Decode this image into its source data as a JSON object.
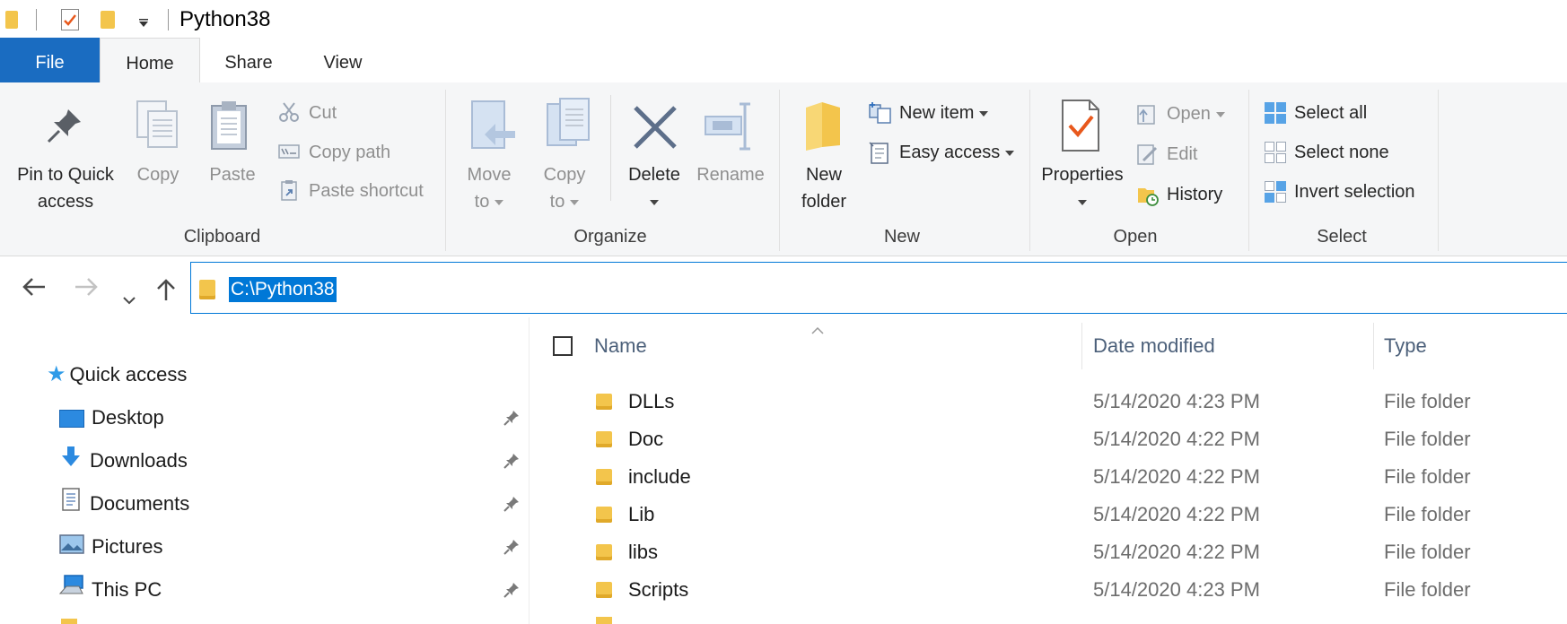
{
  "window": {
    "title": "Python38"
  },
  "tabs": {
    "file": "File",
    "home": "Home",
    "share": "Share",
    "view": "View"
  },
  "ribbon": {
    "clipboard": {
      "label": "Clipboard",
      "pin_line1": "Pin to Quick",
      "pin_line2": "access",
      "copy": "Copy",
      "paste": "Paste",
      "cut": "Cut",
      "copy_path": "Copy path",
      "paste_shortcut": "Paste shortcut"
    },
    "organize": {
      "label": "Organize",
      "move_line1": "Move",
      "move_line2": "to",
      "copy_line1": "Copy",
      "copy_line2": "to",
      "delete": "Delete",
      "rename": "Rename"
    },
    "new": {
      "label": "New",
      "folder_line1": "New",
      "folder_line2": "folder",
      "new_item": "New item",
      "easy_access": "Easy access"
    },
    "open": {
      "label": "Open",
      "properties": "Properties",
      "open": "Open",
      "edit": "Edit",
      "history": "History"
    },
    "select": {
      "label": "Select",
      "select_all": "Select all",
      "select_none": "Select none",
      "invert": "Invert selection"
    }
  },
  "address": {
    "path": "C:\\Python38"
  },
  "nav": {
    "quick_access": "Quick access",
    "items": [
      "Desktop",
      "Downloads",
      "Documents",
      "Pictures",
      "This PC"
    ]
  },
  "columns": {
    "name": "Name",
    "date": "Date modified",
    "type": "Type"
  },
  "files": [
    {
      "name": "DLLs",
      "date": "5/14/2020 4:23 PM",
      "type": "File folder"
    },
    {
      "name": "Doc",
      "date": "5/14/2020 4:22 PM",
      "type": "File folder"
    },
    {
      "name": "include",
      "date": "5/14/2020 4:22 PM",
      "type": "File folder"
    },
    {
      "name": "Lib",
      "date": "5/14/2020 4:22 PM",
      "type": "File folder"
    },
    {
      "name": "libs",
      "date": "5/14/2020 4:22 PM",
      "type": "File folder"
    },
    {
      "name": "Scripts",
      "date": "5/14/2020 4:23 PM",
      "type": "File folder"
    }
  ],
  "colors": {
    "accent": "#0078d7",
    "file_tab": "#1a6cc1",
    "folder": "#f3c54c"
  }
}
